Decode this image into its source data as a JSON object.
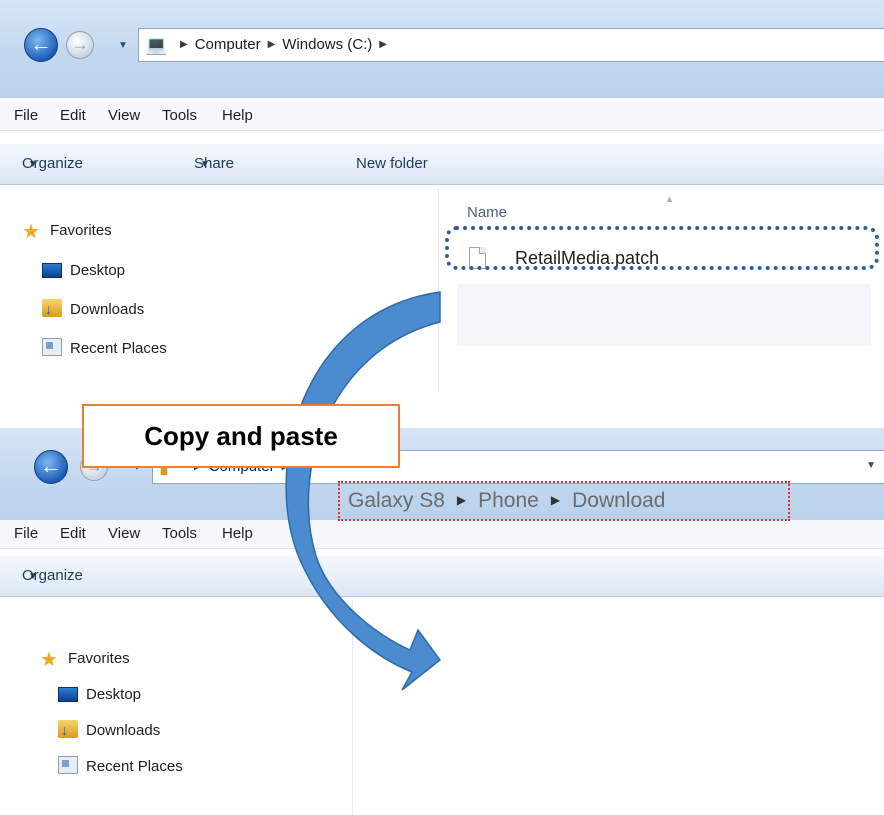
{
  "top_window": {
    "path": [
      "Computer",
      "Windows (C:)"
    ],
    "menu": [
      "File",
      "Edit",
      "View",
      "Tools",
      "Help"
    ],
    "toolbar": {
      "organize": "Organize",
      "share_with": "Share with",
      "new_folder": "New folder"
    },
    "nav": {
      "favorites": "Favorites",
      "items": [
        "Desktop",
        "Downloads",
        "Recent Places"
      ]
    },
    "column_header": "Name",
    "file_name": "RetailMedia.patch"
  },
  "bottom_window": {
    "path_root": "Computer",
    "destination": [
      "Galaxy S8",
      "Phone",
      "Download"
    ],
    "menu": [
      "File",
      "Edit",
      "View",
      "Tools",
      "Help"
    ],
    "toolbar": {
      "organize": "Organize"
    },
    "nav": {
      "favorites": "Favorites",
      "items": [
        "Desktop",
        "Downloads",
        "Recent Places"
      ]
    }
  },
  "callout": "Copy and paste",
  "colors": {
    "arrow": "#4a8ccf",
    "highlight": "#2f5f95",
    "dest_highlight": "#e03030",
    "callout_border": "#ed7d31"
  }
}
